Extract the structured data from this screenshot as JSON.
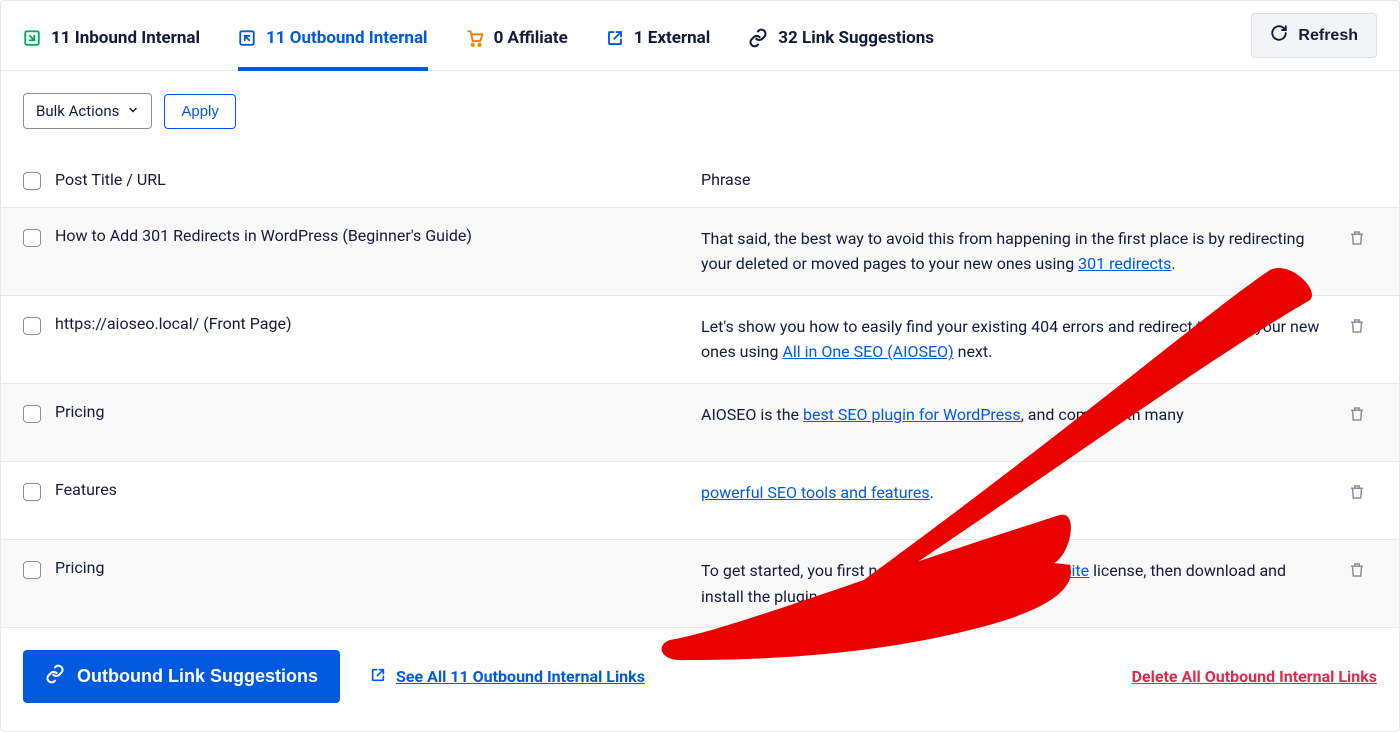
{
  "tabs": {
    "inbound": "11 Inbound Internal",
    "outbound": "11 Outbound Internal",
    "affiliate": "0 Affiliate",
    "external": "1 External",
    "suggestions": "32 Link Suggestions"
  },
  "refresh_label": "Refresh",
  "bulk_actions_label": "Bulk Actions",
  "apply_label": "Apply",
  "table": {
    "col_title": "Post Title / URL",
    "col_phrase": "Phrase"
  },
  "rows": [
    {
      "title": "How to Add 301 Redirects in WordPress (Beginner's Guide)",
      "phrase_pre": "That said, the best way to avoid this from happening in the first place is by redirecting your deleted or moved pages to your new ones using ",
      "phrase_link": "301 redirects",
      "phrase_post": "."
    },
    {
      "title": "https://aioseo.local/ (Front Page)",
      "phrase_pre": "Let's show you how to easily find your existing 404 errors and redirect them to your new ones using ",
      "phrase_link": "All in One SEO (AIOSEO)",
      "phrase_post": " next."
    },
    {
      "title": "Pricing",
      "phrase_pre": "AIOSEO is the ",
      "phrase_link": "best SEO plugin for WordPress",
      "phrase_post": ", and comes with many"
    },
    {
      "title": "Features",
      "phrase_pre": "",
      "phrase_link": "powerful SEO tools and features",
      "phrase_post": "."
    },
    {
      "title": "Pricing",
      "phrase_pre": "To get started, you first need to ",
      "phrase_link": "get AIOSEO Pro or Elite",
      "phrase_post": " license, then download and install the plugin."
    }
  ],
  "footer": {
    "primary_btn": "Outbound Link Suggestions",
    "see_all": "See All 11 Outbound Internal Links",
    "delete_all": "Delete All Outbound Internal Links"
  }
}
